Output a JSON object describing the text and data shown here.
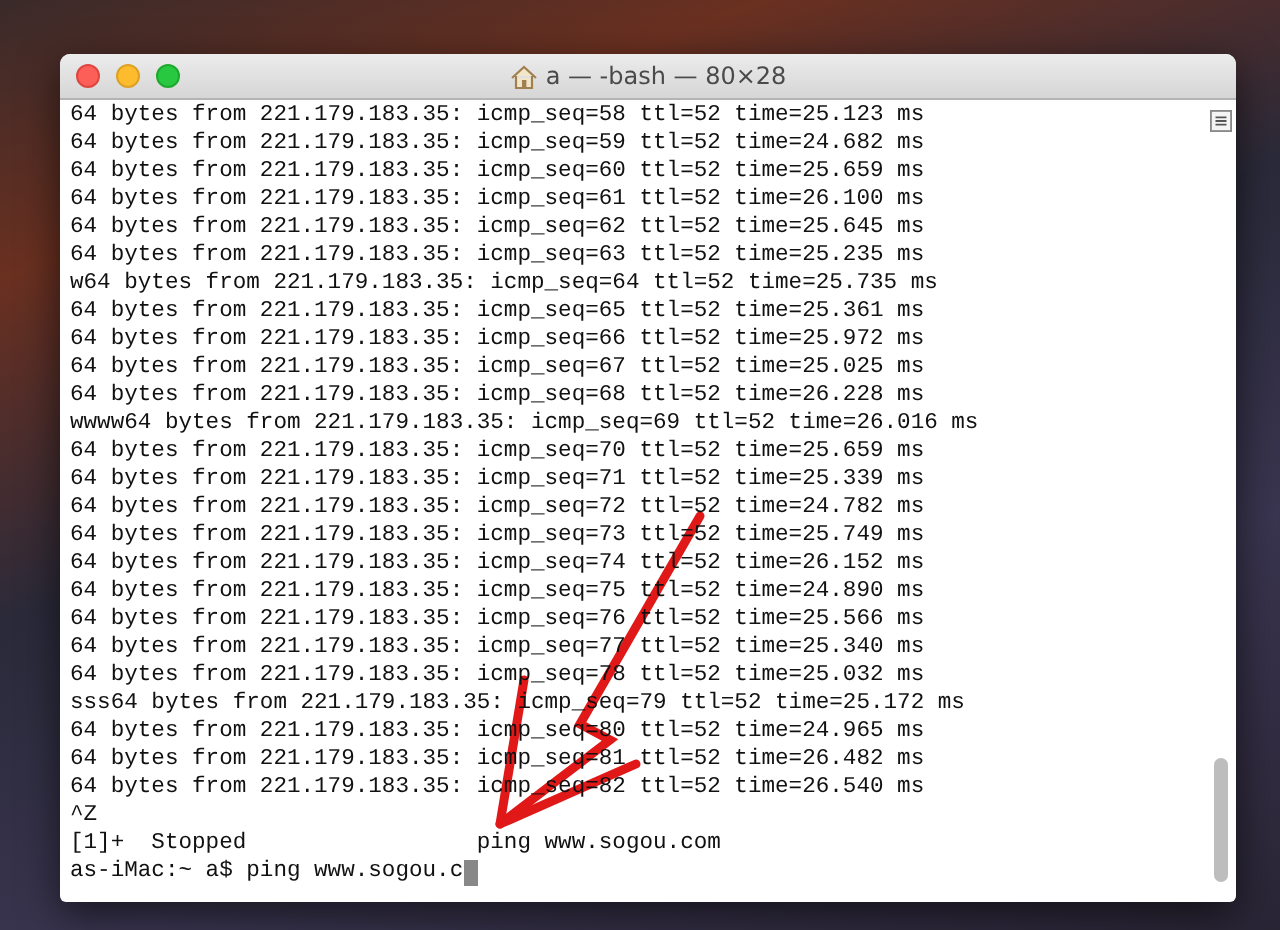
{
  "window": {
    "title": "a — -bash — 80×28"
  },
  "terminal": {
    "lines": [
      "64 bytes from 221.179.183.35: icmp_seq=58 ttl=52 time=25.123 ms",
      "64 bytes from 221.179.183.35: icmp_seq=59 ttl=52 time=24.682 ms",
      "64 bytes from 221.179.183.35: icmp_seq=60 ttl=52 time=25.659 ms",
      "64 bytes from 221.179.183.35: icmp_seq=61 ttl=52 time=26.100 ms",
      "64 bytes from 221.179.183.35: icmp_seq=62 ttl=52 time=25.645 ms",
      "64 bytes from 221.179.183.35: icmp_seq=63 ttl=52 time=25.235 ms",
      "w64 bytes from 221.179.183.35: icmp_seq=64 ttl=52 time=25.735 ms",
      "64 bytes from 221.179.183.35: icmp_seq=65 ttl=52 time=25.361 ms",
      "64 bytes from 221.179.183.35: icmp_seq=66 ttl=52 time=25.972 ms",
      "64 bytes from 221.179.183.35: icmp_seq=67 ttl=52 time=25.025 ms",
      "64 bytes from 221.179.183.35: icmp_seq=68 ttl=52 time=26.228 ms",
      "wwww64 bytes from 221.179.183.35: icmp_seq=69 ttl=52 time=26.016 ms",
      "64 bytes from 221.179.183.35: icmp_seq=70 ttl=52 time=25.659 ms",
      "64 bytes from 221.179.183.35: icmp_seq=71 ttl=52 time=25.339 ms",
      "64 bytes from 221.179.183.35: icmp_seq=72 ttl=52 time=24.782 ms",
      "64 bytes from 221.179.183.35: icmp_seq=73 ttl=52 time=25.749 ms",
      "64 bytes from 221.179.183.35: icmp_seq=74 ttl=52 time=26.152 ms",
      "64 bytes from 221.179.183.35: icmp_seq=75 ttl=52 time=24.890 ms",
      "64 bytes from 221.179.183.35: icmp_seq=76 ttl=52 time=25.566 ms",
      "64 bytes from 221.179.183.35: icmp_seq=77 ttl=52 time=25.340 ms",
      "64 bytes from 221.179.183.35: icmp_seq=78 ttl=52 time=25.032 ms",
      "sss64 bytes from 221.179.183.35: icmp_seq=79 ttl=52 time=25.172 ms",
      "64 bytes from 221.179.183.35: icmp_seq=80 ttl=52 time=24.965 ms",
      "64 bytes from 221.179.183.35: icmp_seq=81 ttl=52 time=26.482 ms",
      "64 bytes from 221.179.183.35: icmp_seq=82 ttl=52 time=26.540 ms",
      "^Z",
      "[1]+  Stopped                 ping www.sogou.com"
    ],
    "prompt": "as-iMac:~ a$ ping www.sogou.c"
  }
}
